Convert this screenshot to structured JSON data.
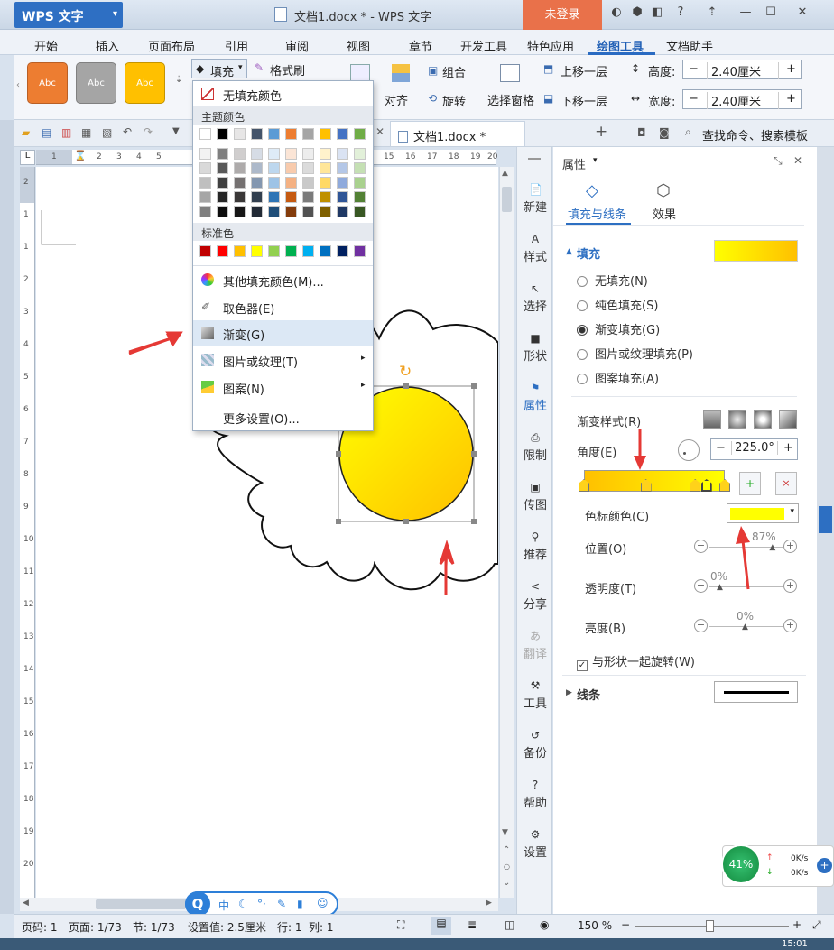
{
  "app": {
    "logo": "WPS 文字",
    "title": "文档1.docx * - WPS 文字",
    "login": "未登录"
  },
  "menu": [
    "开始",
    "插入",
    "页面布局",
    "引用",
    "审阅",
    "视图",
    "章节",
    "开发工具",
    "特色应用",
    "绘图工具",
    "文档助手"
  ],
  "ribbon": {
    "style_box": [
      "Abc",
      "Abc",
      "Abc"
    ],
    "fill": "填充",
    "format_brush": "格式刷",
    "group": "组合",
    "align": "对齐",
    "rotate": "旋转",
    "selection_pane": "选择窗格",
    "bring_forward": "上移一层",
    "send_backward": "下移一层",
    "height_label": "高度:",
    "height_value": "2.40厘米",
    "width_label": "宽度:",
    "width_value": "2.40厘米"
  },
  "doc_tab": "文档1.docx *",
  "search": "查找命令、搜索模板",
  "ruler_h": [
    "1",
    "2",
    "3",
    "4",
    "5",
    "15",
    "16",
    "17",
    "18",
    "19",
    "20"
  ],
  "ruler_v": [
    "2",
    "1",
    "1",
    "2",
    "3",
    "4",
    "5",
    "6",
    "7",
    "8",
    "9",
    "10",
    "11",
    "12",
    "13",
    "14",
    "15",
    "16",
    "17",
    "18",
    "19",
    "20"
  ],
  "fill_menu": {
    "no_fill": "无填充颜色",
    "theme_colors": "主题颜色",
    "standard_colors": "标准色",
    "more_colors": "其他填充颜色(M)...",
    "eyedropper": "取色器(E)",
    "gradient": "渐变(G)",
    "picture_texture": "图片或纹理(T)",
    "pattern": "图案(N)",
    "more_settings": "更多设置(O)...",
    "theme_top": [
      "#ffffff",
      "#000000",
      "#e7e6e6",
      "#44546a",
      "#5b9bd5",
      "#ed7d31",
      "#a5a5a5",
      "#ffc000",
      "#4472c4",
      "#70ad47"
    ],
    "theme_shades": [
      [
        "#f2f2f2",
        "#7f7f7f",
        "#d0cece",
        "#d6dce5",
        "#deebf7",
        "#fbe5d6",
        "#ededed",
        "#fff2cc",
        "#dae3f3",
        "#e2f0d9"
      ],
      [
        "#d9d9d9",
        "#595959",
        "#aeabab",
        "#adb9ca",
        "#bdd7ee",
        "#f8cbad",
        "#dbdbdb",
        "#ffe699",
        "#b4c7e7",
        "#c5e0b4"
      ],
      [
        "#bfbfbf",
        "#404040",
        "#757171",
        "#8497b0",
        "#9dc3e6",
        "#f4b183",
        "#c9c9c9",
        "#ffd966",
        "#8faadc",
        "#a9d18e"
      ],
      [
        "#a6a6a6",
        "#262626",
        "#3a3838",
        "#323f4f",
        "#2e75b6",
        "#c55a11",
        "#7b7b7b",
        "#bf9000",
        "#2f5597",
        "#538135"
      ],
      [
        "#7f7f7f",
        "#0d0d0d",
        "#171616",
        "#222a35",
        "#1f4e79",
        "#843c0c",
        "#525252",
        "#7f6000",
        "#1f3864",
        "#385723"
      ]
    ],
    "standard": [
      "#c00000",
      "#ff0000",
      "#ffc000",
      "#ffff00",
      "#92d050",
      "#00b050",
      "#00b0f0",
      "#0070c0",
      "#002060",
      "#7030a0"
    ]
  },
  "sidebar": [
    "新建",
    "样式",
    "选择",
    "形状",
    "属性",
    "限制",
    "传图",
    "推荐",
    "分享",
    "翻译",
    "工具",
    "备份",
    "帮助",
    "设置"
  ],
  "panel": {
    "title": "属性",
    "tab_fill_line": "填充与线条",
    "tab_effect": "效果",
    "fill_section": "填充",
    "options": [
      "无填充(N)",
      "纯色填充(S)",
      "渐变填充(G)",
      "图片或纹理填充(P)",
      "图案填充(A)"
    ],
    "selected_option": "渐变填充(G)",
    "gradient_style": "渐变样式(R)",
    "angle_label": "角度(E)",
    "angle_value": "225.0°",
    "stop_color": "色标颜色(C)",
    "position_label": "位置(O)",
    "position_value": "87%",
    "transparency_label": "透明度(T)",
    "transparency_value": "0%",
    "brightness_label": "亮度(B)",
    "brightness_value": "0%",
    "rotate_with_shape": "与形状一起旋转(W)",
    "line_section": "线条",
    "stop_positions": [
      0,
      0.44,
      0.79,
      0.87,
      1.0
    ]
  },
  "status": {
    "page": "页码: 1",
    "pages": "页面: 1/73",
    "section": "节: 1/73",
    "setting": "设置值: 2.5厘米",
    "row": "行: 1",
    "col": "列: 1",
    "zoom": "150 %"
  },
  "network": {
    "percent": "41%",
    "up": "0K/s",
    "down": "0K/s"
  },
  "clock": "15:01",
  "ime": [
    "中",
    "⸝",
    "•",
    "⚑",
    "⌂",
    "☺"
  ]
}
